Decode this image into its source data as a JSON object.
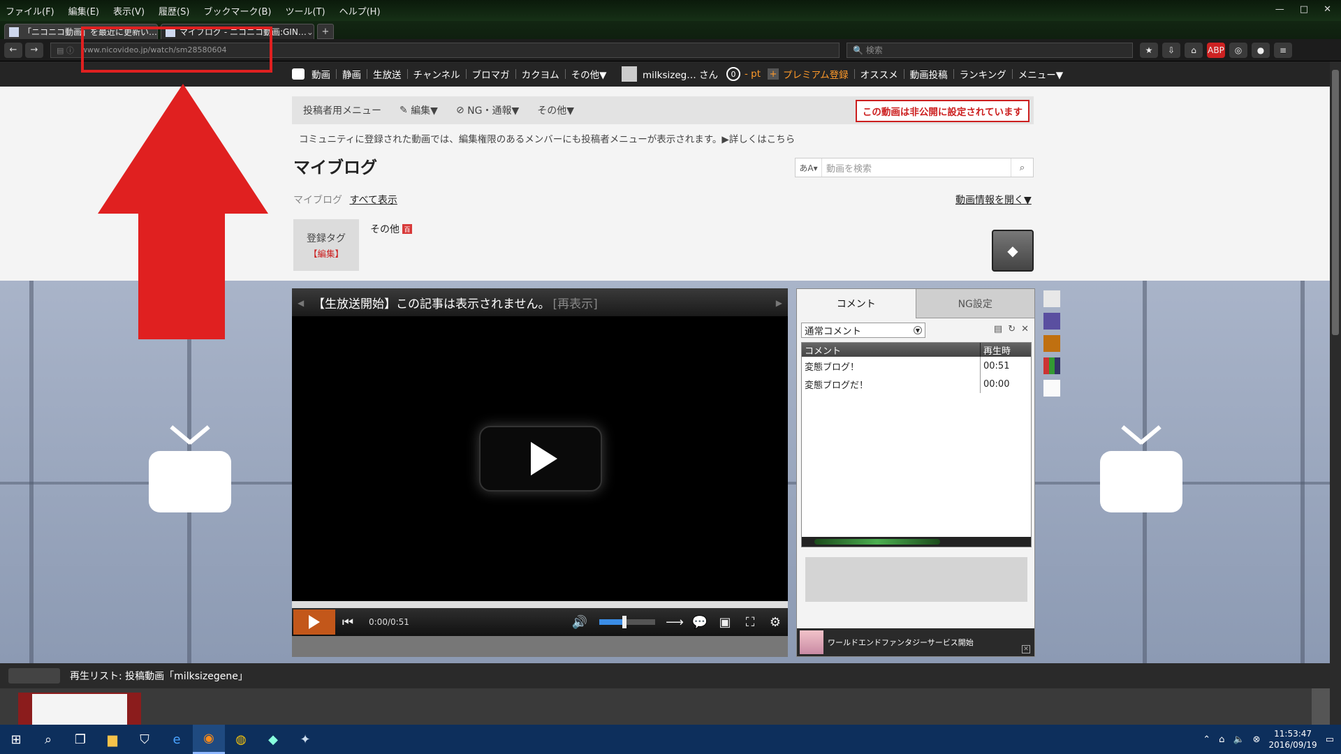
{
  "browser": {
    "menu": [
      "ファイル(F)",
      "編集(E)",
      "表示(V)",
      "履歴(S)",
      "ブックマーク(B)",
      "ツール(T)",
      "ヘルプ(H)"
    ],
    "window_buttons": [
      "—",
      "□",
      "✕"
    ],
    "tabs": [
      {
        "title": "「ニコニコ動画」を最近に更新い…"
      },
      {
        "title": "マイブログ - ニコニコ動画:GIN…"
      }
    ],
    "url": "www.nicovideo.jp/watch/sm28580604",
    "search_placeholder": "検索"
  },
  "nico_header": {
    "nav": [
      "動画",
      "静画",
      "生放送",
      "チャンネル",
      "ブロマガ",
      "カクヨム",
      "その他▼"
    ],
    "user_name": "milksizeg… さん",
    "points": "0",
    "pt_label": "- pt",
    "premium": "プレミアム登録",
    "right_nav": [
      "オススメ",
      "動画投稿",
      "ランキング",
      "メニュー▼"
    ]
  },
  "owner_menu": {
    "label": "投稿者用メニュー",
    "edit": "編集▼",
    "ng_report": "NG・通報▼",
    "other": "その他▼",
    "private_notice": "この動画は非公開に設定されています"
  },
  "community_note": "コミュニティに登録された動画では、編集権限のあるメンバーにも投稿者メニューが表示されます。▶詳しくはこちら",
  "video": {
    "title": "マイブログ",
    "search_lang": "あA▾",
    "search_placeholder": "動画を検索",
    "breadcrumb_label": "マイブログ",
    "breadcrumb_all": "すべて表示",
    "open_info": "動画情報を開く▼",
    "tag_box_label": "登録タグ",
    "tag_box_edit": "【編集】",
    "tag": "その他",
    "tag_dic_icon": "百"
  },
  "player": {
    "marquee": "【生放送開始】この記事は表示されません。",
    "marquee_redisplay": "[再表示]",
    "time": "0:00/0:51",
    "volume_level": 0.45
  },
  "comments": {
    "tab_comment": "コメント",
    "tab_ng": "NG設定",
    "select": "通常コメント",
    "col_comment": "コメント",
    "col_time": "再生時",
    "rows": [
      {
        "text": "変態ブログ！",
        "time": "00:51"
      },
      {
        "text": "変態ブログだ！",
        "time": "00:00"
      }
    ],
    "news": "ワールドエンドファンタジーサービス開始"
  },
  "playlist": {
    "label": "再生リスト: 投稿動画「milksizegene」"
  },
  "taskbar": {
    "time": "11:53:47",
    "date": "2016/09/19"
  },
  "colors": {
    "accent_orange": "#c3571a",
    "alert_red": "#cc1f1f",
    "premium_orange": "#ff9a2a",
    "annotation_red": "#e02020"
  }
}
